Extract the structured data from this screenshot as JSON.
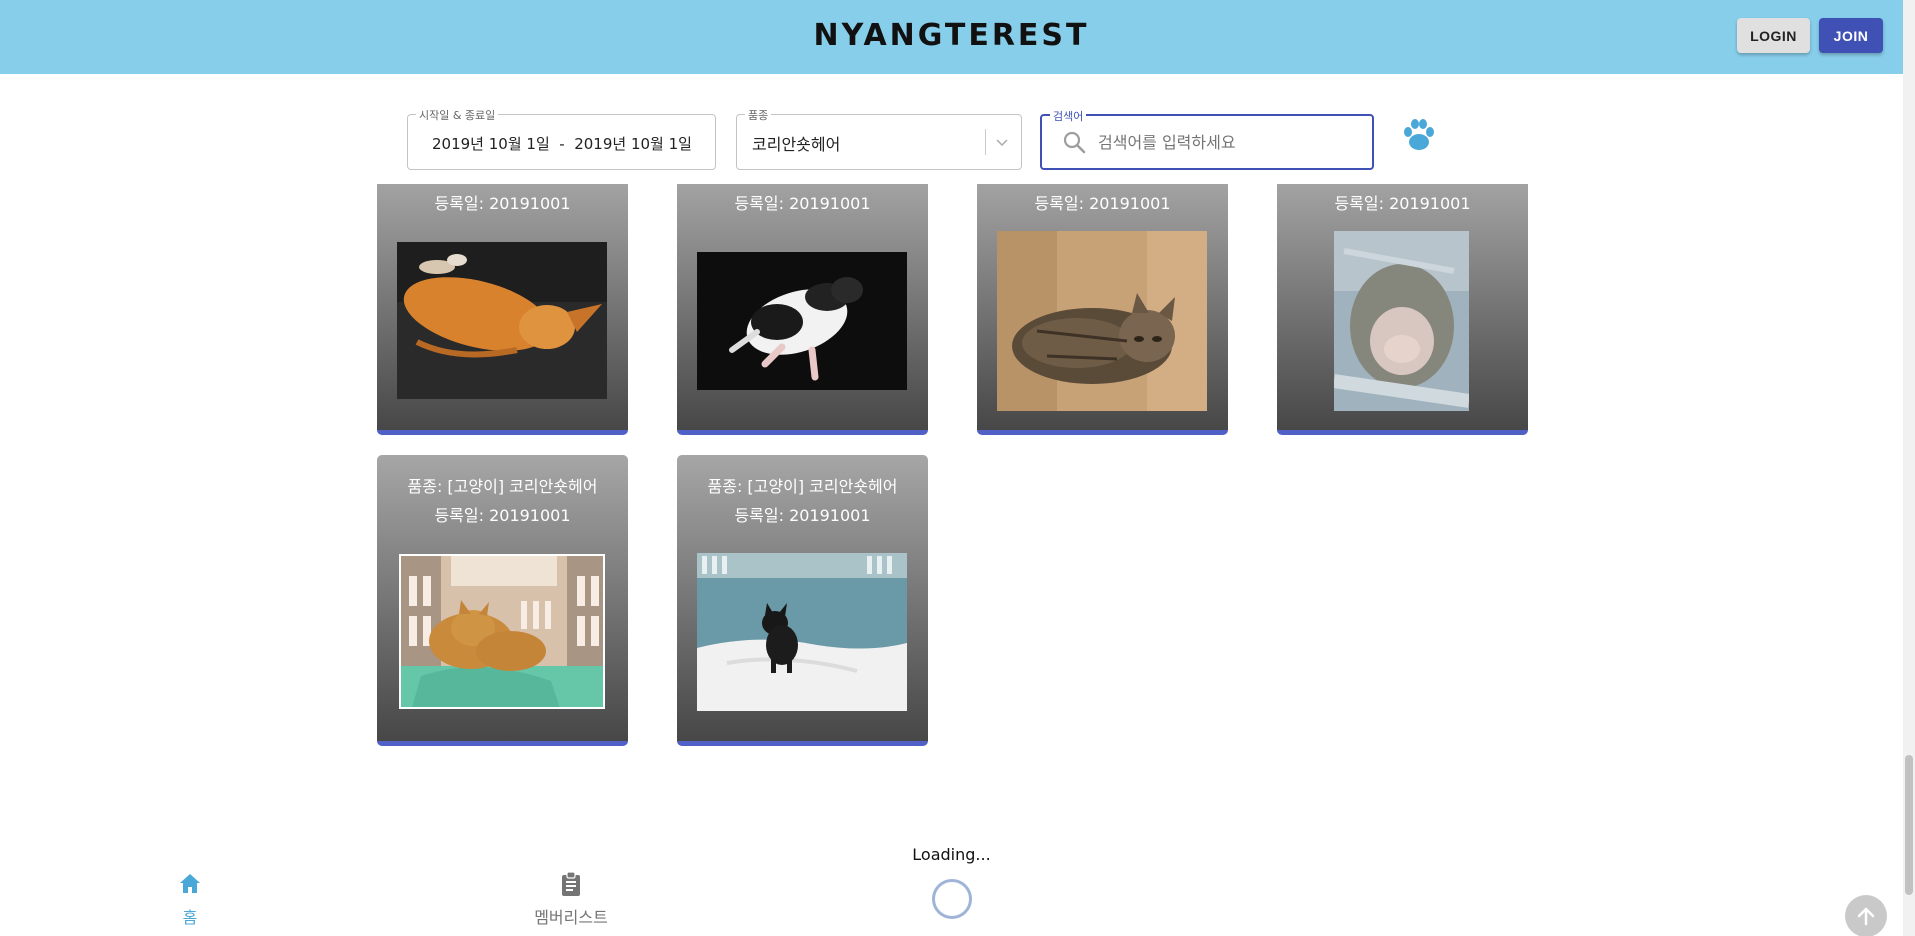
{
  "header": {
    "logo": "NYANGTEREST",
    "login_label": "LOGIN",
    "join_label": "JOIN"
  },
  "filters": {
    "date_label": "시작일 & 종료일",
    "date_value": "2019년 10월 1일  -  2019년 10월 1일",
    "breed_label": "품종",
    "breed_value": "코리안숏헤어",
    "search_label": "검색어",
    "search_placeholder": "검색어를 입력하세요"
  },
  "cards": [
    {
      "registered": "등록일: 20191001",
      "photo": "orange-cat-lying"
    },
    {
      "registered": "등록일: 20191001",
      "photo": "white-black-kitten"
    },
    {
      "registered": "등록일: 20191001",
      "photo": "tabby-kitten-in-box"
    },
    {
      "registered": "등록일: 20191001",
      "photo": "gray-kitten-closeup"
    },
    {
      "breed": "품종: [고양이] 코리안숏헤어",
      "registered": "등록일: 20191001",
      "photo": "orange-cat-in-carrier"
    },
    {
      "breed": "품종: [고양이] 코리안숏헤어",
      "registered": "등록일: 20191001",
      "photo": "black-kitten-in-crate"
    }
  ],
  "loading": {
    "text": "Loading..."
  },
  "bottom_nav": {
    "home_label": "홈",
    "members_label": "멤버리스트"
  },
  "colors": {
    "header_bg": "#87ceeb",
    "accent": "#3f51b5",
    "nav_active": "#4aa8d8",
    "card_border": "#5060c6"
  }
}
